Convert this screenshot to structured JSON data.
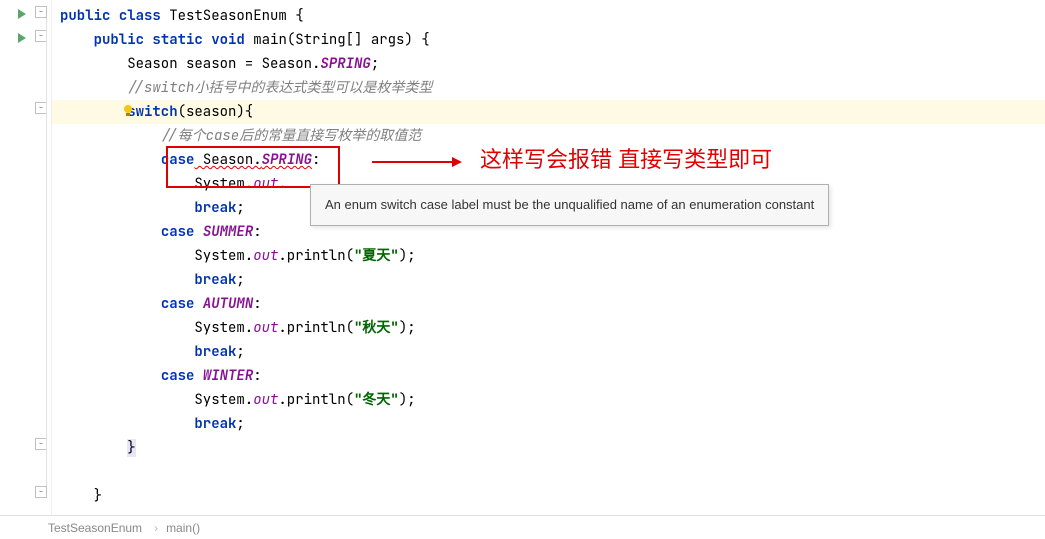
{
  "code": {
    "line1_kw1": "public",
    "line1_kw2": "class",
    "line1_name": " TestSeasonEnum {",
    "line2_kw1": "public",
    "line2_kw2": "static",
    "line2_kw3": "void",
    "line2_rest": " main(String[] args) {",
    "line3": "        Season season = Season.",
    "line3_enum": "SPRING",
    "line3_end": ";",
    "line4_comment": "        //switch小括号中的表达式类型可以是枚举类型",
    "line5_kw": "switch",
    "line5_rest": "(season){",
    "line6_comment": "            //每个case后的常量直接写枚举的取值范",
    "line7_kw": "case",
    "line7_err": " Season.",
    "line7_err2": "SPRING",
    "line7_end": ":",
    "line8": "                System.",
    "line8_field": "out",
    "line8_end": ".",
    "line9_kw": "break",
    "line9_end": ";",
    "line10_kw": "case",
    "line10_enum": " SUMMER",
    "line10_end": ":",
    "line11": "                System.",
    "line11_field": "out",
    "line11_mid": ".println(",
    "line11_str": "\"夏天\"",
    "line11_end": ");",
    "line12_kw": "break",
    "line12_end": ";",
    "line13_kw": "case",
    "line13_enum": " AUTUMN",
    "line13_end": ":",
    "line14": "                System.",
    "line14_field": "out",
    "line14_mid": ".println(",
    "line14_str": "\"秋天\"",
    "line14_end": ");",
    "line15_kw": "break",
    "line15_end": ";",
    "line16_kw": "case",
    "line16_enum": " WINTER",
    "line16_end": ":",
    "line17": "                System.",
    "line17_field": "out",
    "line17_mid": ".println(",
    "line17_str": "\"冬天\"",
    "line17_end": ");",
    "line18_kw": "break",
    "line18_end": ";",
    "line19": "        ",
    "line19_brace": "}",
    "line20": "",
    "line21": "    }"
  },
  "annotation": {
    "text": "这样写会报错  直接写类型即可"
  },
  "tooltip": {
    "text": "An enum switch case label must be the unqualified name of an enumeration constant"
  },
  "breadcrumb": {
    "item1": "TestSeasonEnum",
    "item2": "main()"
  }
}
